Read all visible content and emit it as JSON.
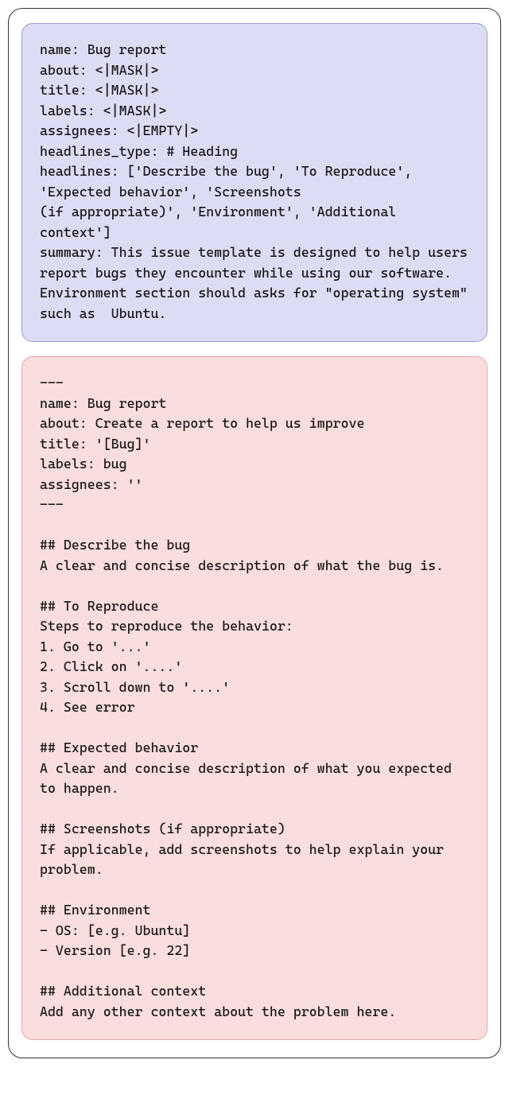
{
  "spec_block": "name: Bug report\nabout: <|MASK|>\ntitle: <|MASK|>\nlabels: <|MASK|>\nassignees: <|EMPTY|>\nheadlines_type: # Heading\nheadlines: ['Describe the bug', 'To Reproduce', 'Expected behavior', 'Screenshots\n(if appropriate)', 'Environment', 'Additional context']\nsummary: This issue template is designed to help users report bugs they encounter while using our software. Environment section should asks for \"operating system\" such as  Ubuntu.",
  "output_block": "---\nname: Bug report\nabout: Create a report to help us improve\ntitle: '[Bug]'\nlabels: bug\nassignees: ''\n---\n\n## Describe the bug\nA clear and concise description of what the bug is.\n\n## To Reproduce\nSteps to reproduce the behavior:\n1. Go to '...'\n2. Click on '....'\n3. Scroll down to '....'\n4. See error\n\n## Expected behavior\nA clear and concise description of what you expected to happen.\n\n## Screenshots (if appropriate)\nIf applicable, add screenshots to help explain your problem.\n\n## Environment\n- OS: [e.g. Ubuntu]\n- Version [e.g. 22]\n\n## Additional context\nAdd any other context about the problem here."
}
